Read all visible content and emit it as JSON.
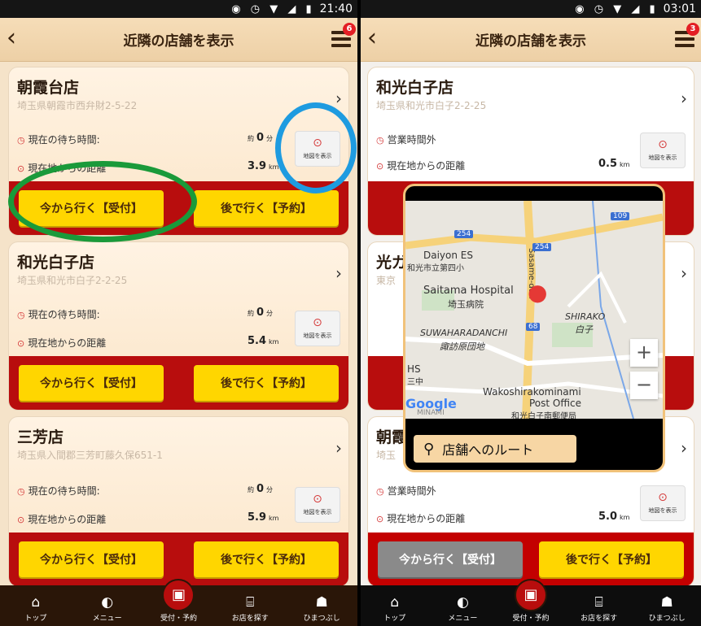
{
  "left": {
    "status": {
      "icons": "◉ ◷ ▼ ◢ ▮",
      "time": "21:40"
    },
    "header": {
      "title": "近隣の店舗を表示",
      "badge": "6"
    },
    "stores": [
      {
        "name": "朝霞台店",
        "address": "埼玉県朝霞市西弁財2-5-22",
        "row1_label": "現在の待ち時間:",
        "row1_prefix": "約",
        "row1_value": "0",
        "row1_unit": "分",
        "row2_label": "現在地からの距離",
        "row2_value": "3.9",
        "row2_unit": "km",
        "map_label": "地図を表示",
        "btn_now": "今から行く【受付】",
        "btn_later": "後で行く【予約】"
      },
      {
        "name": "和光白子店",
        "address": "埼玉県和光市白子2-2-25",
        "row1_label": "現在の待ち時間:",
        "row1_prefix": "約",
        "row1_value": "0",
        "row1_unit": "分",
        "row2_label": "現在地からの距離",
        "row2_value": "5.4",
        "row2_unit": "km",
        "map_label": "地図を表示",
        "btn_now": "今から行く【受付】",
        "btn_later": "後で行く【予約】"
      },
      {
        "name": "三芳店",
        "address": "埼玉県入間郡三芳町藤久保651-1",
        "row1_label": "現在の待ち時間:",
        "row1_prefix": "約",
        "row1_value": "0",
        "row1_unit": "分",
        "row2_label": "現在地からの距離",
        "row2_value": "5.9",
        "row2_unit": "km",
        "map_label": "地図を表示",
        "btn_now": "今から行く【受付】",
        "btn_later": "後で行く【予約】"
      }
    ]
  },
  "right": {
    "status": {
      "icons": "◉ ◷ ▼ ◢ ▮",
      "time": "03:01"
    },
    "header": {
      "title": "近隣の店舗を表示",
      "badge": "3"
    },
    "stores": [
      {
        "name": "和光白子店",
        "address": "埼玉県和光市白子2-2-25",
        "row1_label": "営業時間外",
        "row2_label": "現在地からの距離",
        "row2_value": "0.5",
        "row2_unit": "km",
        "map_label": "地図を表示"
      },
      {
        "name": "光ガ",
        "address": "東京"
      },
      {
        "name": "朝霞",
        "address": "埼玉",
        "row1_label": "営業時間外",
        "row2_label": "現在地からの距離",
        "row2_value": "5.0",
        "row2_unit": "km",
        "map_label": "地図を表示",
        "btn_now": "今から行く【受付】",
        "btn_later": "後で行く【予約】"
      }
    ],
    "map_popup": {
      "labels": {
        "daiyon": "Daiyon ES",
        "daiyon_jp": "和光市立第四小",
        "hospital": "Saitama Hospital",
        "hospital_jp": "埼玉病院",
        "suwahara": "SUWAHARADANCHI",
        "suwahara_jp": "諏訪原団地",
        "shirako": "SHIRAKO",
        "shirako_jp": "白子",
        "post": "Wakoshirakominami",
        "post2": "Post Office",
        "post_jp": "和光白子南郵便局",
        "hs": "HS",
        "hs_jp": "三中",
        "road": "Sasame-dori",
        "r254a": "254",
        "r254b": "254",
        "r68": "68",
        "r109": "109",
        "google": "Google",
        "minami": "MINAMI"
      },
      "zoom_in": "+",
      "zoom_out": "−",
      "route_label": "店舗へのルート"
    }
  },
  "tabbar": [
    {
      "label": "トップ",
      "icon": "⌂"
    },
    {
      "label": "メニュー",
      "icon": "◐"
    },
    {
      "label": "受付・予約",
      "icon": "▣"
    },
    {
      "label": "お店を探す",
      "icon": "⌸"
    },
    {
      "label": "ひまつぶし",
      "icon": "☗"
    }
  ],
  "colors": {
    "accent_red": "#b80d0d",
    "button_yellow": "#ffd600",
    "annotation_green": "#1a9a3a",
    "annotation_blue": "#1e9be0"
  }
}
